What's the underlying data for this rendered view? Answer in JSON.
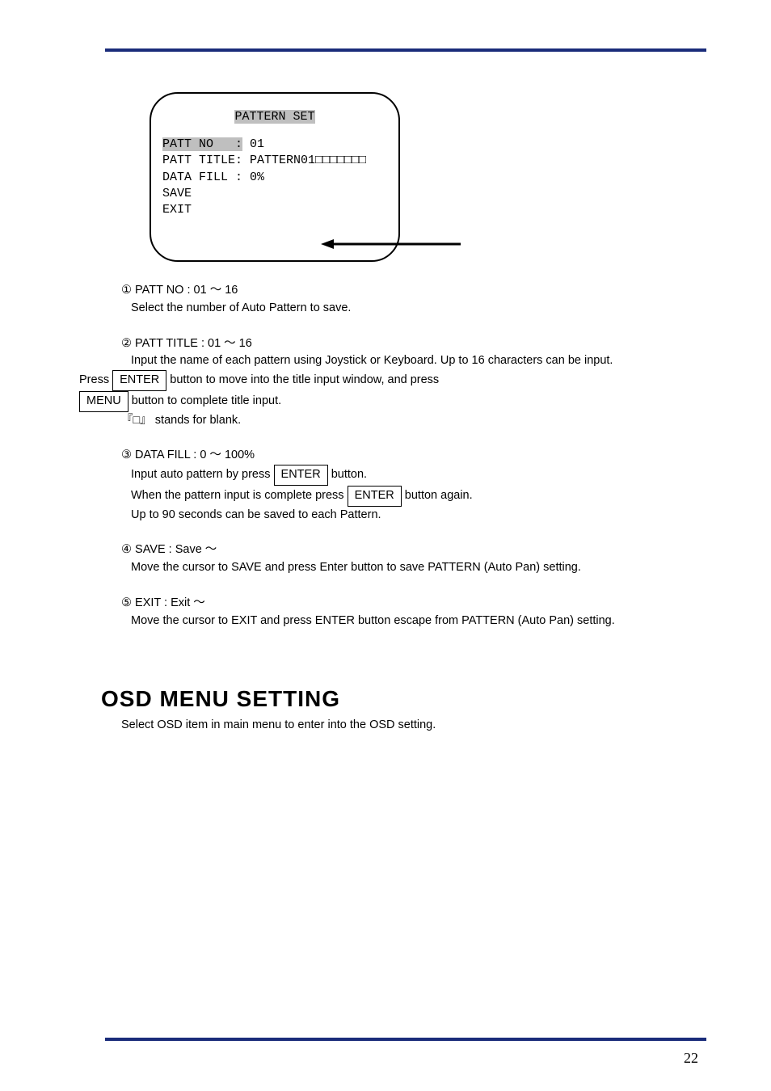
{
  "menu": {
    "title": "PATTERN SET",
    "line_pattno_label": "PATT NO   :",
    "line_pattno_value": " 01",
    "line_patttitle": "PATT TITLE: PATTERN01□□□□□□□",
    "line_datafill": "DATA FILL : 0%",
    "line_save": "SAVE",
    "line_exit": "EXIT"
  },
  "desc": {
    "p1": "① PATT NO : 01 〜 16",
    "p1d": "Select the number of Auto Pattern to save.",
    "p2": "② PATT TITLE : 01 〜 16",
    "p2d1": "Input the name of each pattern using Joystick or Keyboard. Up to 16 characters can be input.",
    "p2d2_prefix": "Press ",
    "p2d2_enter": "ENTER",
    "p2d2_mid": " button to move into the title input window, and press ",
    "p2d2_menu": "MENU",
    "p2d2_suffix": " button to complete title input.",
    "p2d3": "『□』 stands for blank.",
    "p3": "③ DATA FILL : 0 〜 100%",
    "p3d1_prefix": "Input auto pattern by press ",
    "p3d1_enter": "ENTER",
    "p3d1_mid": " button.",
    "p3d2_prefix": "When the pattern input is complete press ",
    "p3d2_enter": "ENTER",
    "p3d2_suffix": " button again.",
    "p3d3": "Up to 90 seconds can be saved to each Pattern.",
    "p4": "④ SAVE : Save 〜",
    "p4d": "Move the cursor to SAVE and press Enter button to save PATTERN (Auto Pan) setting.",
    "p5": "⑤ EXIT : Exit 〜",
    "p5d": "Move the cursor to EXIT and press ENTER button escape from PATTERN (Auto Pan) setting."
  },
  "osd": {
    "heading": "OSD MENU SETTING",
    "subtitle": "Select OSD item in main menu to enter into the OSD setting."
  },
  "page_number": "22"
}
